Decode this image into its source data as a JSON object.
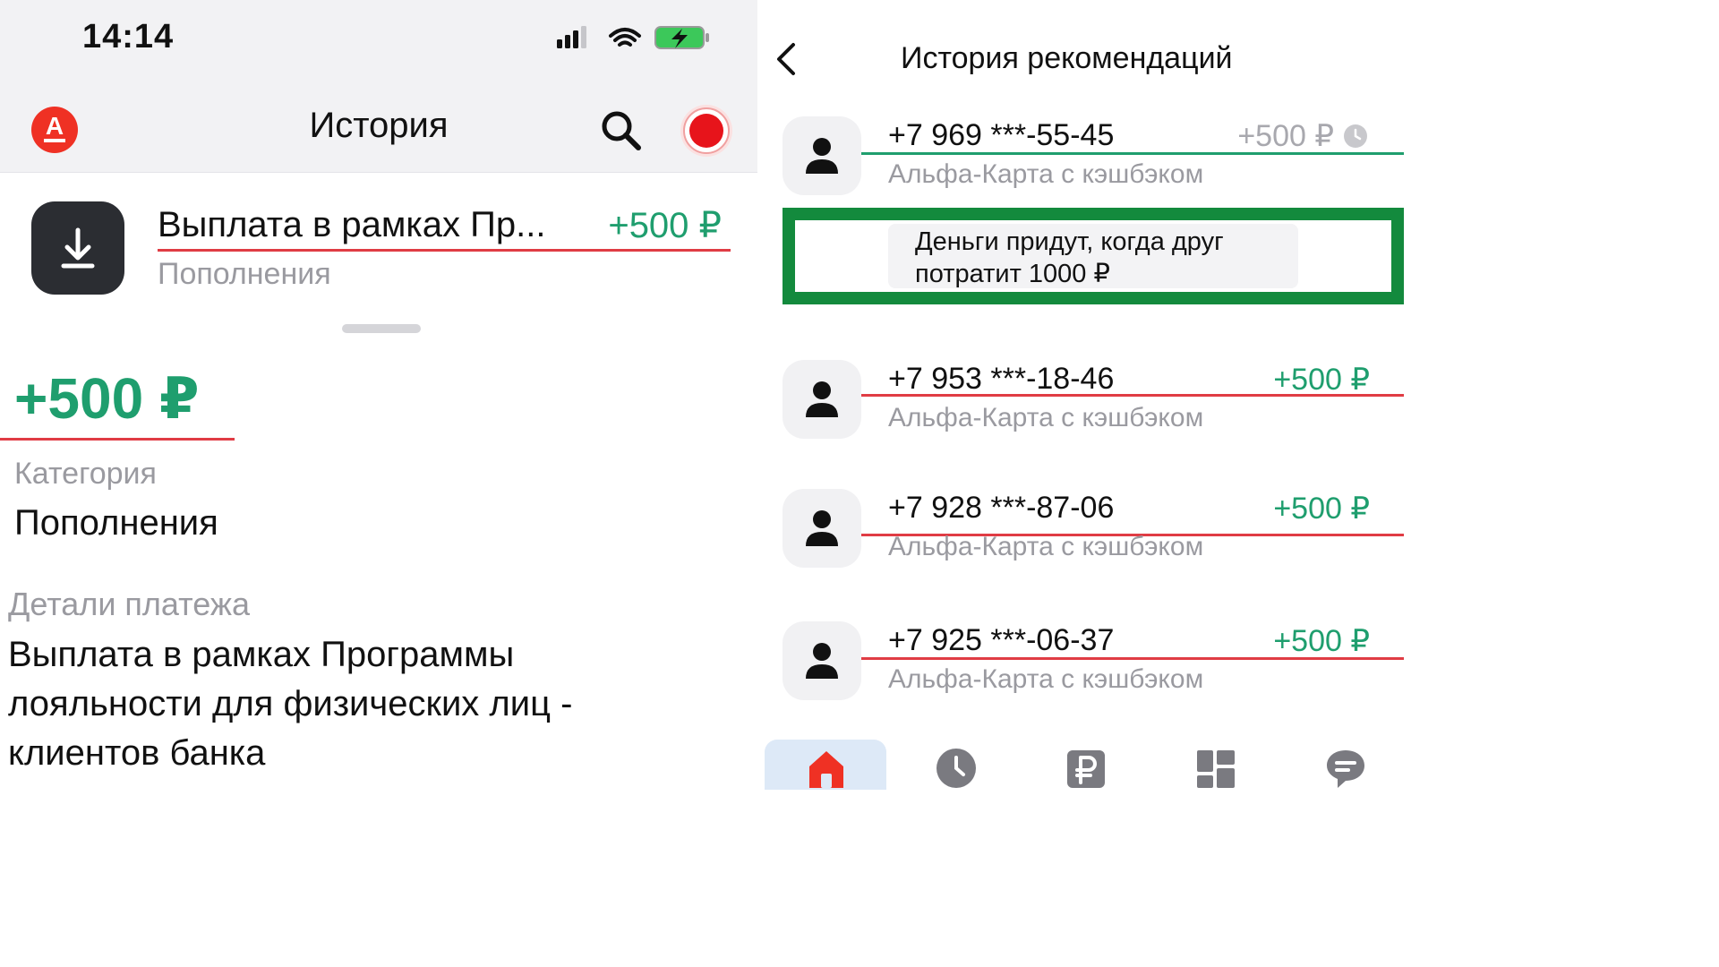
{
  "left": {
    "status": {
      "time": "14:14"
    },
    "header": {
      "brand_letter": "A",
      "title": "История"
    },
    "operation": {
      "title": "Выплата в рамках Пр...",
      "amount": "+500 ₽",
      "category": "Пополнения"
    },
    "detail": {
      "amount": "+500 ₽",
      "category_label": "Категория",
      "category_value": "Пополнения",
      "details_label": "Детали платежа",
      "details_value": "Выплата в рамках Программы лояльности для физических лиц - клиентов банка"
    }
  },
  "right": {
    "header": {
      "title": "История рекомендаций"
    },
    "referrals": [
      {
        "phone": "+7 969 ***-55-45",
        "amount": "+500 ₽",
        "card": "Альфа-Карта с кэшбэком",
        "status": "pending"
      },
      {
        "phone": "+7 953 ***-18-46",
        "amount": "+500 ₽",
        "card": "Альфа-Карта с кэшбэком",
        "status": "done"
      },
      {
        "phone": "+7 928 ***-87-06",
        "amount": "+500 ₽",
        "card": "Альфа-Карта с кэшбэком",
        "status": "done"
      },
      {
        "phone": "+7 925 ***-06-37",
        "amount": "+500 ₽",
        "card": "Альфа-Карта с кэшбэком",
        "status": "done"
      }
    ],
    "tooltip": "Деньги придут, когда друг потратит 1000 ₽",
    "tabbar": [
      "home-icon",
      "history-clock-icon",
      "payments-ruble-icon",
      "services-grid-icon",
      "chat-icon"
    ]
  },
  "colors": {
    "brand_red": "#ef3124",
    "income_green": "#1f9e6e",
    "highlight_green": "#138a3d",
    "underline_red": "#e03c44",
    "muted_text": "#9a9aa0"
  }
}
